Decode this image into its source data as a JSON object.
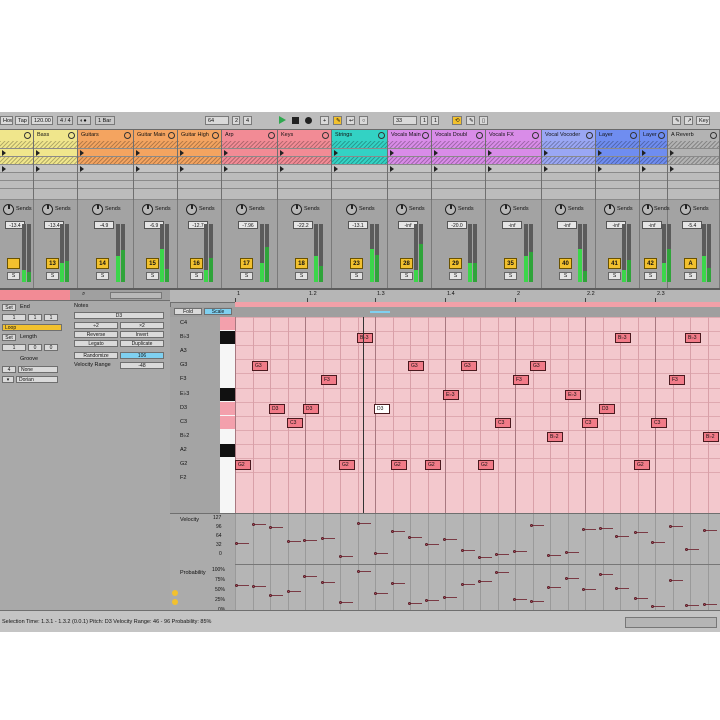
{
  "transport": {
    "items": [
      "How",
      "Tap",
      "120.00",
      "4 / 4",
      "1 Bar",
      "64",
      "2",
      "4",
      "33",
      "1",
      "1"
    ],
    "key_label": "Key"
  },
  "tracks": [
    {
      "name": "",
      "color": "#f0e68c",
      "num": "",
      "vol": "-13.4"
    },
    {
      "name": "Bass",
      "color": "#f0e68c",
      "num": "13",
      "vol": "-13.4"
    },
    {
      "name": "Guitars",
      "color": "#f4a460",
      "num": "14",
      "vol": "-4.9"
    },
    {
      "name": "Guitar Main",
      "color": "#f4a460",
      "num": "15",
      "vol": "-6.9"
    },
    {
      "name": "Guitar High",
      "color": "#f4a460",
      "num": "16",
      "vol": "-12.7"
    },
    {
      "name": "Arp",
      "color": "#f28b95",
      "num": "17",
      "vol": "-7.96"
    },
    {
      "name": "Keys",
      "color": "#f28b95",
      "num": "18",
      "vol": "-22.2"
    },
    {
      "name": "Strings",
      "color": "#33d2c4",
      "num": "23",
      "vol": "-13.1"
    },
    {
      "name": "Vocals Main",
      "color": "#d98ce8",
      "num": "28",
      "vol": "-inf"
    },
    {
      "name": "Vocals Doubl",
      "color": "#d98ce8",
      "num": "29",
      "vol": "-20.0"
    },
    {
      "name": "Vocals FX",
      "color": "#d98ce8",
      "num": "35",
      "vol": "-inf"
    },
    {
      "name": "Vocal Vocoder",
      "color": "#9aa7f4",
      "num": "40",
      "vol": "-inf"
    },
    {
      "name": "Layer",
      "color": "#6f8df0",
      "num": "41",
      "vol": "-inf"
    },
    {
      "name": "Layer",
      "color": "#6f8df0",
      "num": "42",
      "vol": "-inf"
    },
    {
      "name": "A Reverb",
      "color": "#b3b3b3",
      "num": "A",
      "vol": "-5.4"
    }
  ],
  "mixer": {
    "sends_label": "Sends",
    "scale": [
      "0",
      "12",
      "24",
      "36",
      "48",
      "60"
    ]
  },
  "clip": {
    "set_label": "Set",
    "end_label": "End",
    "loop_label": "Loop",
    "length_label": "Length",
    "groove_label": "Groove",
    "groove_value": "None",
    "scale_value": "Dorian",
    "f1": "1",
    "f2": "1",
    "f3": "1",
    "f4": "1",
    "f5": "4"
  },
  "notes_panel": {
    "title": "Notes",
    "pitch": "D3",
    "div2": "÷2",
    "mul2": "×2",
    "reverse": "Reverse",
    "invert": "Invert",
    "legato": "Legato",
    "duplicate": "Duplicate",
    "randomize": "Randomize",
    "randomize_val": "106",
    "velocity_range": "Velocity Range",
    "velocity_val": "-48"
  },
  "editor": {
    "fold": "Fold",
    "scale": "Scale",
    "ruler": [
      "1",
      "1.2",
      "1.3",
      "1.4",
      "2",
      "2.2",
      "2.3"
    ],
    "note_names": [
      "C4",
      "B♭3",
      "A3",
      "G3",
      "F3",
      "E♭3",
      "D3",
      "C3",
      "B♭2",
      "A2",
      "G2",
      "F2"
    ],
    "velocity_label": "Velocity",
    "vel_scale": [
      "127",
      "96",
      "64",
      "32",
      "0"
    ],
    "prob_label": "Probability",
    "prob_scale": [
      "100%",
      "75%",
      "50%",
      "25%",
      "0%"
    ]
  },
  "status": {
    "text": "Selection   Time: 1.3.1 - 1.3.2 (0.0.1)   Pitch: D3   Velocity Range: 46 - 96   Probability: 85%"
  }
}
